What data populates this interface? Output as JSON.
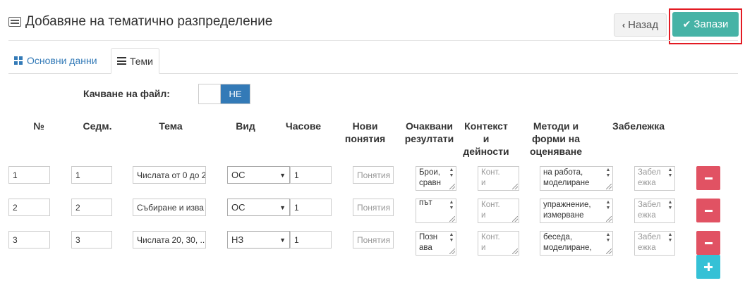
{
  "header": {
    "title": "Добавяне на тематично разпределение",
    "back_label": "Назад",
    "save_label": "Запази"
  },
  "tabs": [
    {
      "label": "Основни данни"
    },
    {
      "label": "Теми"
    }
  ],
  "upload": {
    "label": "Качване на файл:",
    "toggle_value": "НЕ"
  },
  "columns": {
    "num": "№",
    "week": "Седм.",
    "topic": "Тема",
    "type": "Вид",
    "hours": "Часове",
    "new_concepts": "Нови\nпонятия",
    "expected_results": "Очаквани\nрезултати",
    "context": "Контекст\nи\nдейности",
    "methods": "Методи и\nформи на\nоценяване",
    "note": "Забележка"
  },
  "placeholders": {
    "concepts": "Понятия",
    "context": "Конт.\nи",
    "note": "Забел\nежка"
  },
  "rows": [
    {
      "num": "1",
      "week": "1",
      "topic": "Числата от 0 до 2",
      "type": "ОС",
      "hours": "1",
      "results": "Брои,\nсравн",
      "methods": "на работа,\nмоделиране"
    },
    {
      "num": "2",
      "week": "2",
      "topic": "Събиране и изва",
      "type": "ОС",
      "hours": "1",
      "results": "път",
      "methods": "упражнение,\nизмерване"
    },
    {
      "num": "3",
      "week": "3",
      "topic": "Числата 20, 30, ..",
      "type": "НЗ",
      "hours": "1",
      "results": "Позн\nава",
      "methods": "беседа,\nмоделиране,"
    }
  ]
}
